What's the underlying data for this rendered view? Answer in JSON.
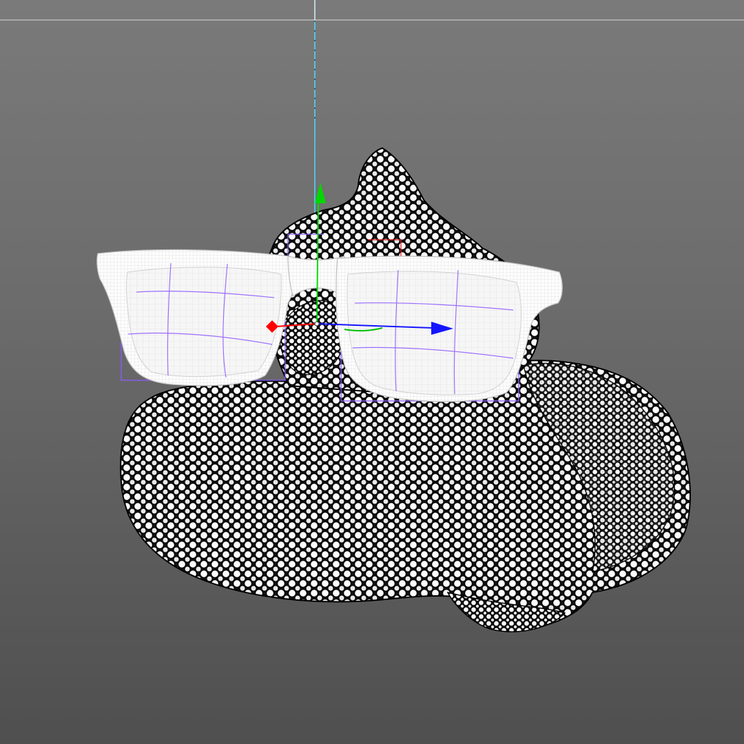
{
  "viewport": {
    "background_top": "#7a7a7a",
    "background_bottom": "#4f4f4f",
    "view": "perspective"
  },
  "scene": {
    "objects": [
      "sculpted-blob-mesh",
      "sunglasses-mesh"
    ],
    "display_mode": "wireframe",
    "mesh_line_color": "#000000",
    "mesh_face_color": "#ffffff",
    "glasses_color": "#f4f4f4",
    "selection_box_color": "#8a5cff"
  },
  "gizmo": {
    "type": "move",
    "x_axis_color": "#ff0000",
    "y_axis_color": "#00e000",
    "z_axis_color": "#1515ff",
    "vertical_guide_color": "#4dd9ff",
    "horizon_line_color": "#c8c8c8"
  }
}
